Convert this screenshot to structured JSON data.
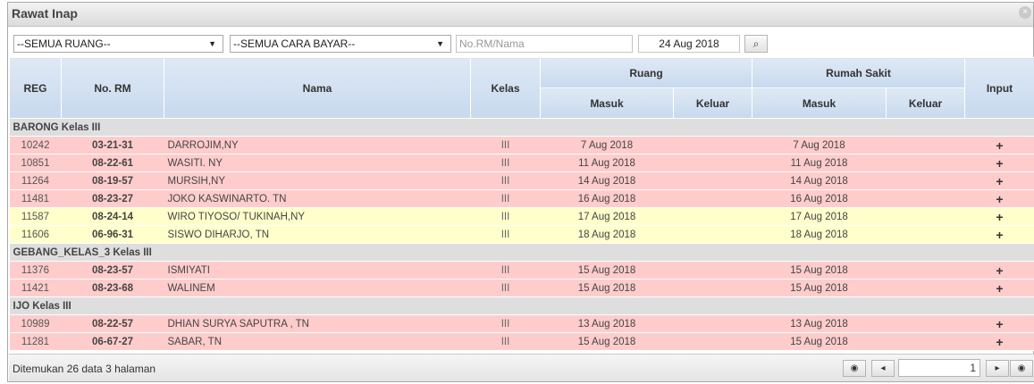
{
  "window": {
    "title": "Rawat Inap",
    "close_icon": "×"
  },
  "toolbar": {
    "ruang_select": "--SEMUA RUANG--",
    "bayar_select": "--SEMUA CARA BAYAR--",
    "search_placeholder": "No.RM/Nama",
    "date_value": "24 Aug 2018",
    "search_icon": "⌕",
    "dropdown_arrow": "▼"
  },
  "table": {
    "headers": {
      "reg": "REG",
      "rm": "No. RM",
      "nama": "Nama",
      "kelas": "Kelas",
      "ruang": "Ruang",
      "rumah_sakit": "Rumah Sakit",
      "input": "Input",
      "masuk": "Masuk",
      "keluar": "Keluar"
    },
    "groups": [
      {
        "name": "BARONG Kelas III",
        "rows": [
          {
            "reg": "10242",
            "rm": "03-21-31",
            "nama": "DARROJIM,NY",
            "kelas": "III",
            "ruang_masuk": "7 Aug 2018",
            "ruang_keluar": "",
            "rs_masuk": "7 Aug 2018",
            "rs_keluar": "",
            "input": "+",
            "color": "pink"
          },
          {
            "reg": "10851",
            "rm": "08-22-61",
            "nama": "WASITI. NY",
            "kelas": "III",
            "ruang_masuk": "11 Aug 2018",
            "ruang_keluar": "",
            "rs_masuk": "11 Aug 2018",
            "rs_keluar": "",
            "input": "+",
            "color": "pink"
          },
          {
            "reg": "11264",
            "rm": "08-19-57",
            "nama": "MURSIH,NY",
            "kelas": "III",
            "ruang_masuk": "14 Aug 2018",
            "ruang_keluar": "",
            "rs_masuk": "14 Aug 2018",
            "rs_keluar": "",
            "input": "+",
            "color": "pink"
          },
          {
            "reg": "11481",
            "rm": "08-23-27",
            "nama": "JOKO KASWINARTO. TN",
            "kelas": "III",
            "ruang_masuk": "16 Aug 2018",
            "ruang_keluar": "",
            "rs_masuk": "16 Aug 2018",
            "rs_keluar": "",
            "input": "+",
            "color": "pink"
          },
          {
            "reg": "11587",
            "rm": "08-24-14",
            "nama": "WIRO TIYOSO/ TUKINAH,NY",
            "kelas": "III",
            "ruang_masuk": "17 Aug 2018",
            "ruang_keluar": "",
            "rs_masuk": "17 Aug 2018",
            "rs_keluar": "",
            "input": "+",
            "color": "yellow"
          },
          {
            "reg": "11606",
            "rm": "06-96-31",
            "nama": "SISWO DIHARJO, TN",
            "kelas": "III",
            "ruang_masuk": "18 Aug 2018",
            "ruang_keluar": "",
            "rs_masuk": "18 Aug 2018",
            "rs_keluar": "",
            "input": "+",
            "color": "yellow"
          }
        ]
      },
      {
        "name": "GEBANG_KELAS_3 Kelas III",
        "rows": [
          {
            "reg": "11376",
            "rm": "08-23-57",
            "nama": "ISMIYATI",
            "kelas": "III",
            "ruang_masuk": "15 Aug 2018",
            "ruang_keluar": "",
            "rs_masuk": "15 Aug 2018",
            "rs_keluar": "",
            "input": "+",
            "color": "pink"
          },
          {
            "reg": "11421",
            "rm": "08-23-68",
            "nama": "WALINEM",
            "kelas": "III",
            "ruang_masuk": "15 Aug 2018",
            "ruang_keluar": "",
            "rs_masuk": "15 Aug 2018",
            "rs_keluar": "",
            "input": "+",
            "color": "pink"
          }
        ]
      },
      {
        "name": "IJO Kelas III",
        "rows": [
          {
            "reg": "10989",
            "rm": "08-22-57",
            "nama": "DHIAN SURYA SAPUTRA , TN",
            "kelas": "III",
            "ruang_masuk": "13 Aug 2018",
            "ruang_keluar": "",
            "rs_masuk": "13 Aug 2018",
            "rs_keluar": "",
            "input": "+",
            "color": "pink"
          },
          {
            "reg": "11281",
            "rm": "06-67-27",
            "nama": "SABAR, TN",
            "kelas": "III",
            "ruang_masuk": "15 Aug 2018",
            "ruang_keluar": "",
            "rs_masuk": "15 Aug 2018",
            "rs_keluar": "",
            "input": "+",
            "color": "pink"
          }
        ]
      }
    ]
  },
  "footer": {
    "info": "Ditemukan 26 data 3 halaman",
    "page_value": "1",
    "first_icon": "◉",
    "prev_icon": "◂",
    "next_icon": "▸",
    "last_icon": "◉"
  },
  "colors": {
    "pink_row": "#ffcccc",
    "yellow_row": "#ffffcc",
    "group_row": "#dedede",
    "header": "#c7d9ee"
  }
}
